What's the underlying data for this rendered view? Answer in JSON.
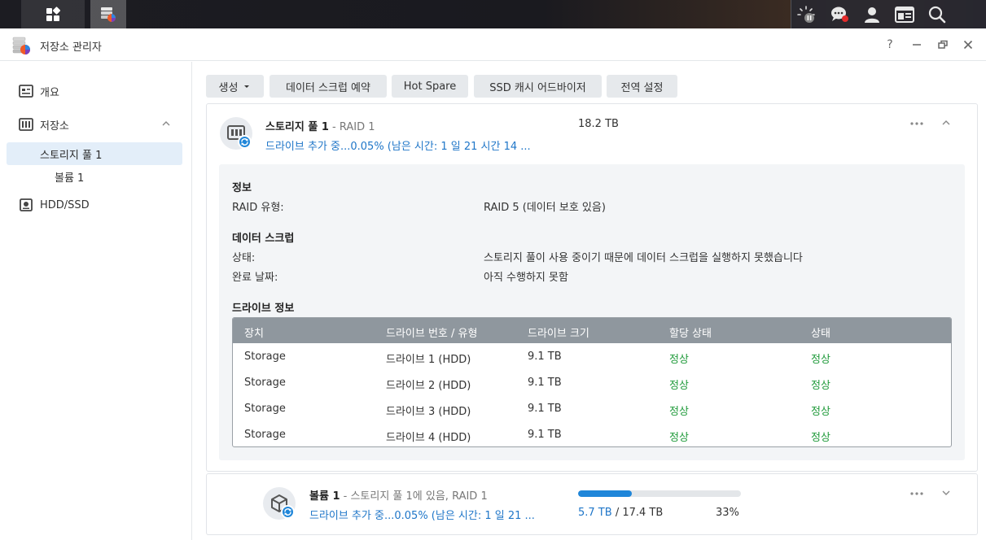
{
  "window": {
    "title": "저장소 관리자",
    "controls": {
      "help": "?",
      "minimize": "–",
      "restore": "",
      "close": "×"
    }
  },
  "taskbar": {
    "left_icons": [
      "main-menu-icon",
      "storage-manager-app-icon"
    ],
    "right_icons": [
      "resource-monitor-icon",
      "notifications-icon",
      "user-icon",
      "widgets-icon",
      "search-icon"
    ]
  },
  "sidebar": {
    "items": [
      {
        "label": "개요",
        "icon": "overview-icon"
      },
      {
        "label": "저장소",
        "icon": "storage-icon"
      },
      {
        "label": "스토리지 풀 1"
      },
      {
        "label": "볼륨 1"
      },
      {
        "label": "HDD/SSD",
        "icon": "hdd-icon"
      }
    ]
  },
  "toolbar": {
    "create": "생성",
    "scrub_schedule": "데이터 스크럽 예약",
    "hot_spare": "Hot Spare",
    "ssd_cache_advisor": "SSD 캐시 어드바이저",
    "global_settings": "전역 설정"
  },
  "pool": {
    "name": "스토리지 풀 1",
    "raid_suffix": "- RAID 1",
    "size": "18.2 TB",
    "status": "드라이브 추가 중...0.05% (남은 시간: 1 일 21 시간 14 ...",
    "info": {
      "section_info": "정보",
      "raid_type_label": "RAID 유형:",
      "raid_type_value": "RAID 5 (데이터 보호 있음)",
      "section_scrub": "데이터 스크럽",
      "state_label": "상태:",
      "state_value": "스토리지 풀이 사용 중이기 때문에 데이터 스크럽을 실행하지 못했습니다",
      "completed_label": "완료 날짜:",
      "completed_value": "아직 수행하지 못함",
      "section_drives": "드라이브 정보"
    },
    "drive_table": {
      "headers": [
        "장치",
        "드라이브 번호 / 유형",
        "드라이브 크기",
        "할당 상태",
        "상태"
      ],
      "rows": [
        [
          "Storage",
          "드라이브 1 (HDD)",
          "9.1 TB",
          "정상",
          "정상"
        ],
        [
          "Storage",
          "드라이브 2 (HDD)",
          "9.1 TB",
          "정상",
          "정상"
        ],
        [
          "Storage",
          "드라이브 3 (HDD)",
          "9.1 TB",
          "정상",
          "정상"
        ],
        [
          "Storage",
          "드라이브 4 (HDD)",
          "9.1 TB",
          "정상",
          "정상"
        ]
      ]
    }
  },
  "volume": {
    "name": "볼륨 1",
    "suffix": "- 스토리지 풀 1에 있음, RAID 1",
    "status": "드라이브 추가 중...0.05% (남은 시간: 1 일 21 ...",
    "used": "5.7 TB",
    "total_sep": "/ 17.4 TB",
    "percent": "33%",
    "usage_fraction": 0.33
  },
  "colors": {
    "accent": "#1f86d9",
    "ok": "#1f9a3a",
    "table_header": "#8f979e"
  }
}
